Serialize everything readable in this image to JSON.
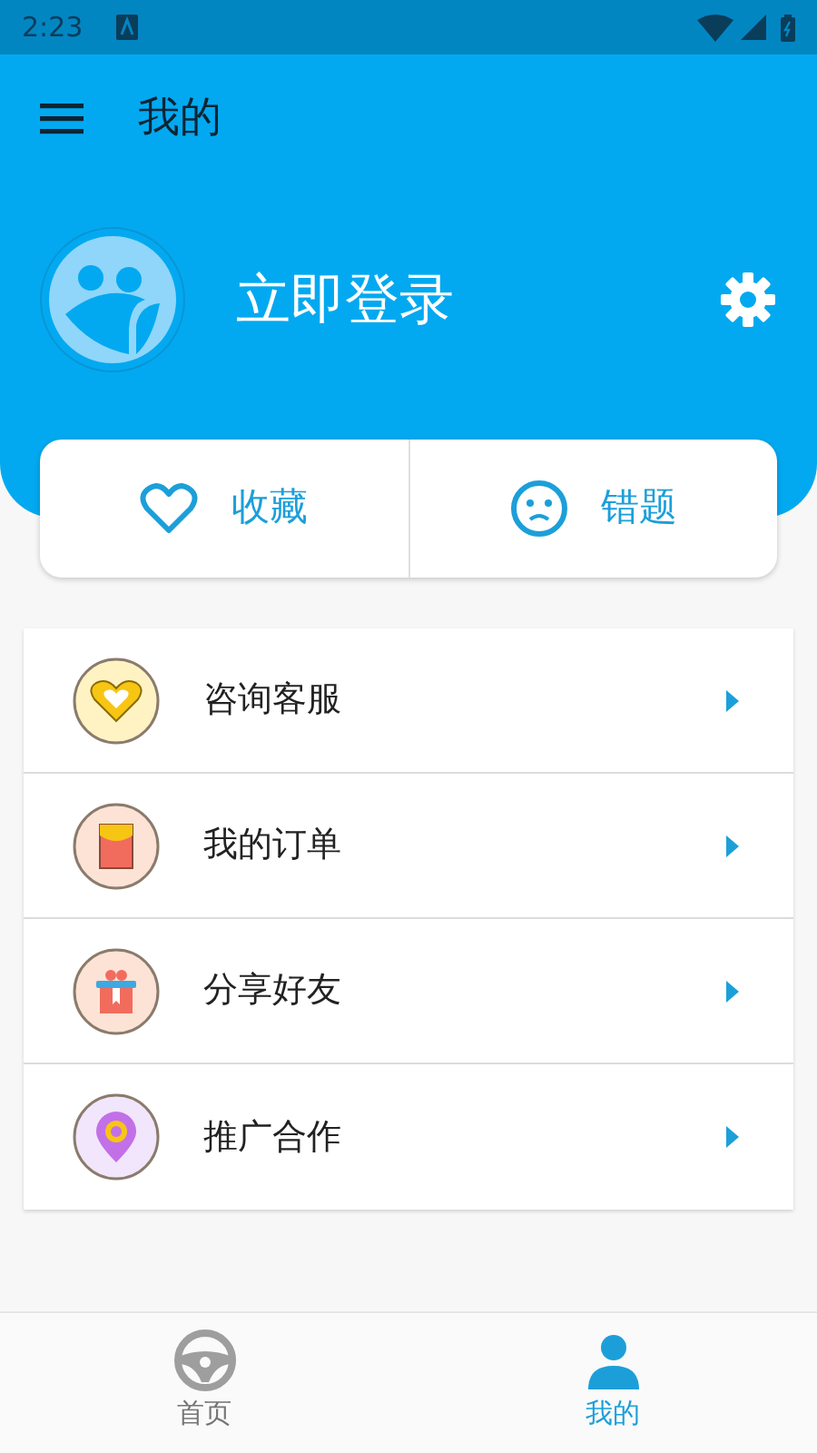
{
  "status_bar": {
    "time": "2:23"
  },
  "toolbar": {
    "title": "我的"
  },
  "profile": {
    "name": "立即登录"
  },
  "quick_actions": [
    {
      "label": "收藏",
      "kind": "heart"
    },
    {
      "label": "错题",
      "kind": "face"
    }
  ],
  "menu": [
    {
      "label": "咨询客服",
      "kind": "heart"
    },
    {
      "label": "我的订单",
      "kind": "envelope"
    },
    {
      "label": "分享好友",
      "kind": "gift"
    },
    {
      "label": "推广合作",
      "kind": "pin"
    }
  ],
  "bottom_nav": [
    {
      "label": "首页",
      "kind": "wheel",
      "selected": false
    },
    {
      "label": "我的",
      "kind": "person",
      "selected": true
    }
  ]
}
